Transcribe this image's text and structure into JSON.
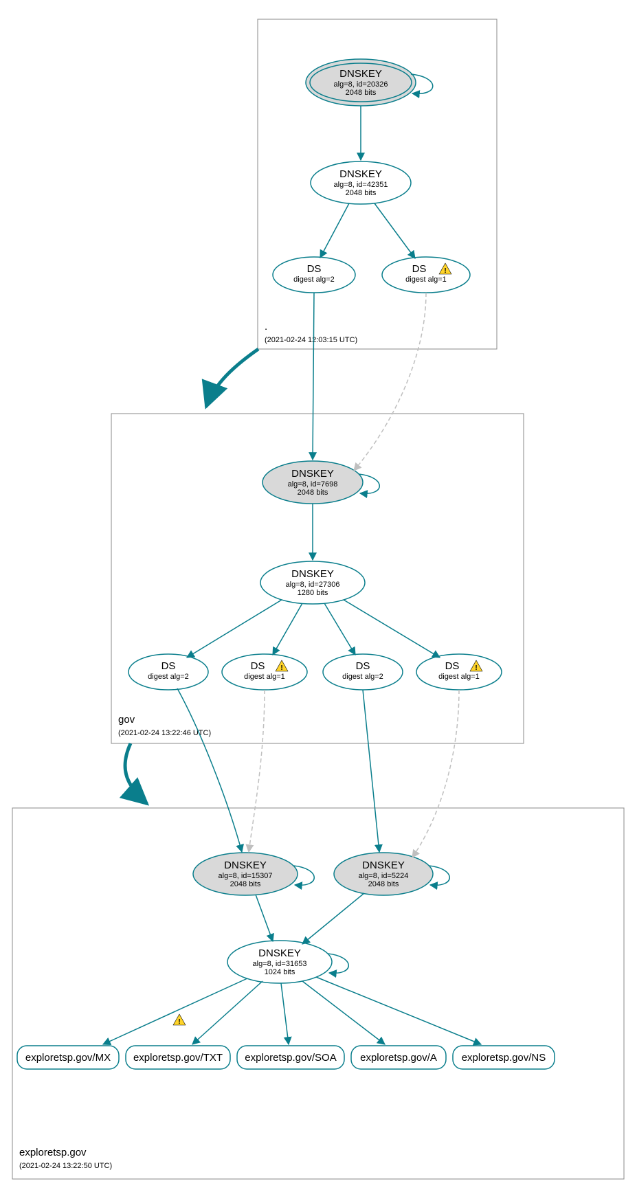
{
  "colors": {
    "stroke": "#0a7e8c",
    "node_fill_shaded": "#d9d9d9",
    "dashed": "#bfbfbf"
  },
  "zones": {
    "root": {
      "title": ".",
      "timestamp": "(2021-02-24 12:03:15 UTC)"
    },
    "gov": {
      "title": "gov",
      "timestamp": "(2021-02-24 13:22:46 UTC)"
    },
    "leaf": {
      "title": "exploretsp.gov",
      "timestamp": "(2021-02-24 13:22:50 UTC)"
    }
  },
  "nodes": {
    "root_ksk": {
      "l1": "DNSKEY",
      "l2": "alg=8, id=20326",
      "l3": "2048 bits"
    },
    "root_zsk": {
      "l1": "DNSKEY",
      "l2": "alg=8, id=42351",
      "l3": "2048 bits"
    },
    "root_ds2": {
      "l1": "DS",
      "l2": "digest alg=2"
    },
    "root_ds1": {
      "l1": "DS",
      "l2": "digest alg=1"
    },
    "gov_ksk": {
      "l1": "DNSKEY",
      "l2": "alg=8, id=7698",
      "l3": "2048 bits"
    },
    "gov_zsk": {
      "l1": "DNSKEY",
      "l2": "alg=8, id=27306",
      "l3": "1280 bits"
    },
    "gov_dsA2": {
      "l1": "DS",
      "l2": "digest alg=2"
    },
    "gov_dsA1": {
      "l1": "DS",
      "l2": "digest alg=1"
    },
    "gov_dsB2": {
      "l1": "DS",
      "l2": "digest alg=2"
    },
    "gov_dsB1": {
      "l1": "DS",
      "l2": "digest alg=1"
    },
    "leaf_kskA": {
      "l1": "DNSKEY",
      "l2": "alg=8, id=15307",
      "l3": "2048 bits"
    },
    "leaf_kskB": {
      "l1": "DNSKEY",
      "l2": "alg=8, id=5224",
      "l3": "2048 bits"
    },
    "leaf_zsk": {
      "l1": "DNSKEY",
      "l2": "alg=8, id=31653",
      "l3": "1024 bits"
    },
    "rr_mx": {
      "label": "exploretsp.gov/MX"
    },
    "rr_txt": {
      "label": "exploretsp.gov/TXT"
    },
    "rr_soa": {
      "label": "exploretsp.gov/SOA"
    },
    "rr_a": {
      "label": "exploretsp.gov/A"
    },
    "rr_ns": {
      "label": "exploretsp.gov/NS"
    }
  },
  "warnings": {
    "root_ds1": true,
    "gov_dsA1": true,
    "gov_dsB1": true,
    "leaf_txt_edge": true
  }
}
